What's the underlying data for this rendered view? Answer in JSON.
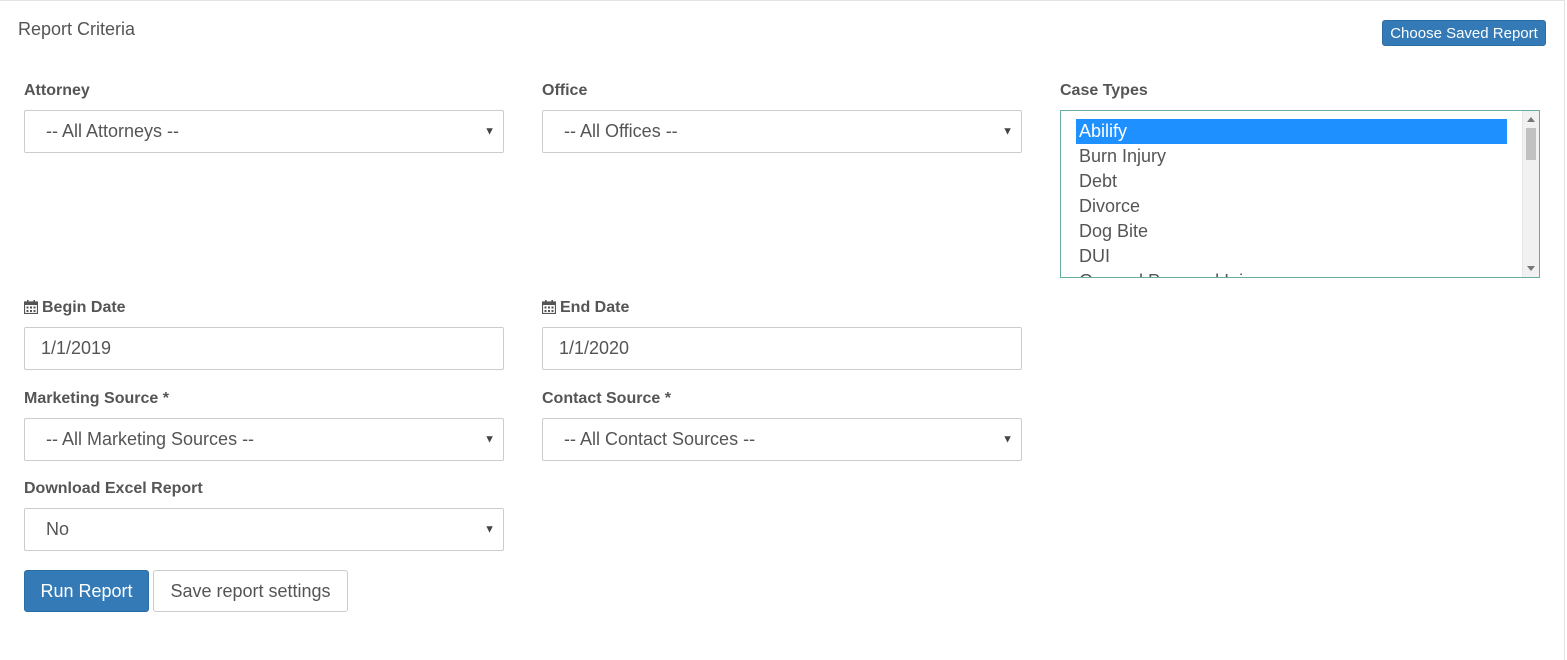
{
  "panel": {
    "title": "Report Criteria",
    "choose_saved_label": "Choose Saved Report"
  },
  "attorney": {
    "label": "Attorney",
    "value": "-- All Attorneys --"
  },
  "office": {
    "label": "Office",
    "value": "-- All Offices --"
  },
  "case_types": {
    "label": "Case Types",
    "options": [
      "Abilify",
      "Burn Injury",
      "Debt",
      "Divorce",
      "Dog Bite",
      "DUI",
      "General Personal Injury"
    ],
    "selected": "Abilify"
  },
  "begin_date": {
    "label": "Begin Date",
    "value": "1/1/2019",
    "icon": "calendar-icon"
  },
  "end_date": {
    "label": "End Date",
    "value": "1/1/2020",
    "icon": "calendar-icon"
  },
  "marketing_source": {
    "label": "Marketing Source *",
    "value": "-- All Marketing Sources --"
  },
  "contact_source": {
    "label": "Contact Source *",
    "value": "-- All Contact Sources --"
  },
  "download_excel": {
    "label": "Download Excel Report",
    "value": "No"
  },
  "actions": {
    "run_label": "Run Report",
    "save_label": "Save report settings"
  },
  "colors": {
    "primary": "#337ab7",
    "selection": "#1e90ff",
    "focus_border": "#66afa0"
  }
}
